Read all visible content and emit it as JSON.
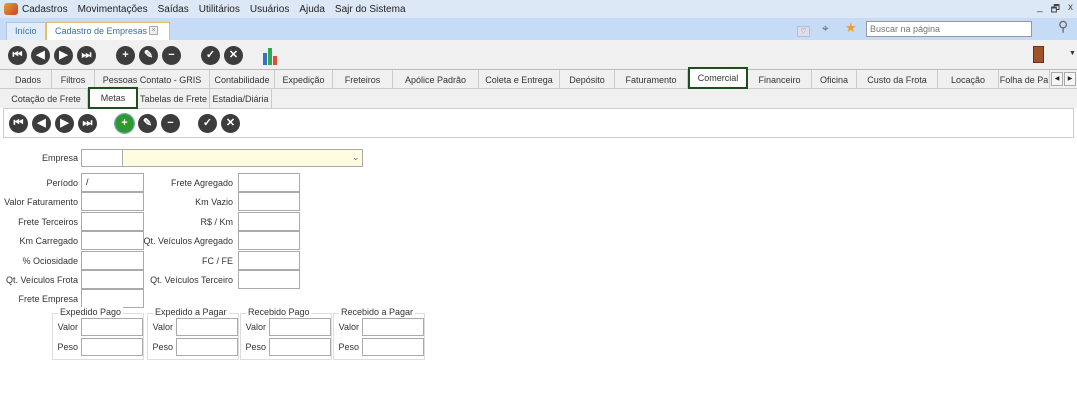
{
  "menu": [
    "Cadastros",
    "Movimentações",
    "Saídas",
    "Utilitários",
    "Usuários",
    "Ajuda",
    "Sajr do Sistema"
  ],
  "window_controls": [
    "_",
    "🗗",
    "x"
  ],
  "doc_tabs": [
    "Início",
    "Cadastro de Empresas"
  ],
  "search": {
    "placeholder": "Buscar na página"
  },
  "main_tabs": [
    "Dados",
    "Filtros",
    "Pessoas Contato - GRIS",
    "Contabilidade",
    "Expedição",
    "Freteiros",
    "Apólice Padrão",
    "Coleta e Entrega",
    "Depósito",
    "Faturamento",
    "Comercial",
    "Financeiro",
    "Oficina",
    "Custo da Frota",
    "Locação",
    "Folha de Pa"
  ],
  "selected_main_tab": "Comercial",
  "sub_tabs": [
    "Cotação de Frete",
    "Metas",
    "Tabelas de Frete",
    "Estadia/Diária"
  ],
  "selected_sub_tab": "Metas",
  "form": {
    "empresa_label": "Empresa",
    "periodo_value": "/",
    "left": [
      "Período",
      "Valor Faturamento",
      "Frete Terceiros",
      "Km Carregado",
      "% Ociosidade",
      "Qt. Veículos Frota",
      "Frete Empresa"
    ],
    "right": [
      "Frete Agregado",
      "Km Vazio",
      "R$ / Km",
      "Qt. Veículos Agregado",
      "FC / FE",
      "Qt. Veículos Terceiro"
    ],
    "groups": [
      "Expedido Pago",
      "Expedido a Pagar",
      "Recebido Pago",
      "Recebido a Pagar"
    ],
    "valor": "Valor",
    "peso": "Peso"
  },
  "colors": {
    "accent_box": "#1e4d1e",
    "add_button": "#2e9a2e",
    "empresa_bg": "#fefbe0"
  }
}
